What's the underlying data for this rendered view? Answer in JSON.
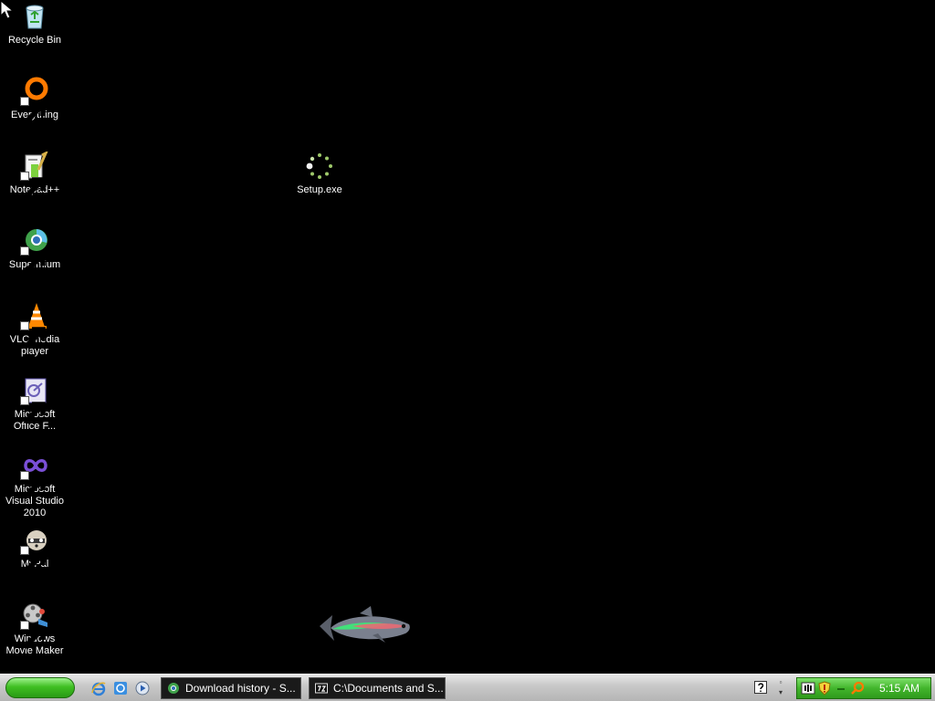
{
  "desktop": {
    "icons": [
      {
        "label": "Recycle Bin"
      },
      {
        "label": "Everything"
      },
      {
        "label": "Notepad++"
      },
      {
        "label": "Supermium"
      },
      {
        "label": "VLC media player"
      },
      {
        "label": "Microsoft Office F..."
      },
      {
        "label": "Microsoft Visual Studio 2010"
      },
      {
        "label": "MyPal"
      },
      {
        "label": "Windows Movie Maker"
      },
      {
        "label": "Setup.exe"
      }
    ]
  },
  "taskbar": {
    "tasks": [
      {
        "label": "Download history - S...",
        "icon": "supermium-icon"
      },
      {
        "label": "C:\\Documents and S...",
        "icon": "7zip-icon"
      }
    ],
    "quick_launch": [
      "internet-explorer-icon",
      "ie-document-icon",
      "media-player-icon"
    ],
    "clock": "5:15 AM"
  },
  "colors": {
    "desktop_background": "#000000",
    "taskbar": "#c9c9c9",
    "start_button": "#3fbf22",
    "tray": "#42b52c",
    "task_button": "#1a1a1a"
  }
}
